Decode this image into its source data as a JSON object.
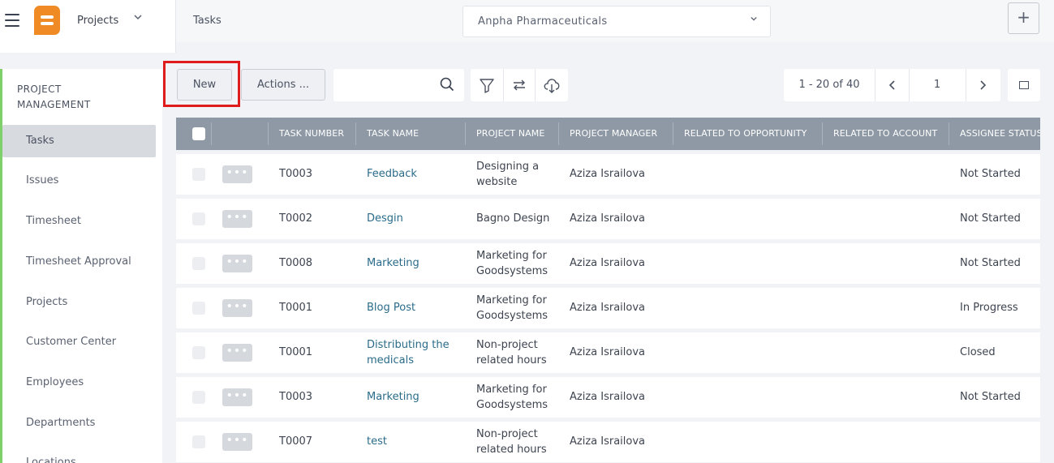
{
  "header": {
    "module_label": "Projects",
    "breadcrumb": "Tasks",
    "company": "Anpha Pharmaceuticals",
    "add_label": "+"
  },
  "sidebar": {
    "section_title_line1": "PROJECT",
    "section_title_line2": "MANAGEMENT",
    "items": [
      {
        "label": "Tasks"
      },
      {
        "label": "Issues"
      },
      {
        "label": "Timesheet"
      },
      {
        "label": "Timesheet Approval"
      },
      {
        "label": "Projects"
      },
      {
        "label": "Customer Center"
      },
      {
        "label": "Employees"
      },
      {
        "label": "Departments"
      },
      {
        "label": "Locations"
      }
    ]
  },
  "toolbar": {
    "new_label": "New",
    "actions_label": "Actions ...",
    "search_placeholder": ""
  },
  "pager": {
    "range": "1 - 20 of 40",
    "page": "1",
    "prev": "‹",
    "next": "›"
  },
  "table": {
    "columns": [
      "TASK NUMBER",
      "TASK NAME",
      "PROJECT NAME",
      "PROJECT MANAGER",
      "RELATED TO OPPORTUNITY",
      "RELATED TO ACCOUNT",
      "ASSIGNEE STATUS"
    ],
    "rows": [
      {
        "num": "T0003",
        "name": [
          "Feedback"
        ],
        "project": [
          "Designing a",
          "website"
        ],
        "manager": "Aziza Israilova",
        "status": "Not Started"
      },
      {
        "num": "T0002",
        "name": [
          "Desgin"
        ],
        "project": [
          "Bagno Design"
        ],
        "manager": "Aziza Israilova",
        "status": "Not Started"
      },
      {
        "num": "T0008",
        "name": [
          "Marketing"
        ],
        "project": [
          "Marketing for",
          "Goodsystems"
        ],
        "manager": "Aziza Israilova",
        "status": "Not Started"
      },
      {
        "num": "T0001",
        "name": [
          "Blog Post"
        ],
        "project": [
          "Marketing for",
          "Goodsystems"
        ],
        "manager": "Aziza Israilova",
        "status": "In Progress"
      },
      {
        "num": "T0001",
        "name": [
          "Distributing the",
          "medicals"
        ],
        "project": [
          "Non-project",
          "related hours"
        ],
        "manager": "Aziza Israilova",
        "status": "Closed"
      },
      {
        "num": "T0003",
        "name": [
          "Marketing"
        ],
        "project": [
          "Marketing for",
          "Goodsystems"
        ],
        "manager": "Aziza Israilova",
        "status": "Not Started"
      },
      {
        "num": "T0007",
        "name": [
          "test"
        ],
        "project": [
          "Non-project",
          "related hours"
        ],
        "manager": "Aziza Israilova",
        "status": ""
      }
    ]
  },
  "colors": {
    "accent": "#f08a24",
    "sidebar_marker": "#7ed16a",
    "table_header": "#8e99a5",
    "link": "#2a6b8a",
    "highlight": "#e01b1b"
  }
}
